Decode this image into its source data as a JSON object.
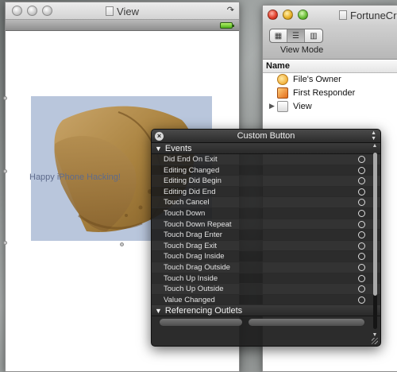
{
  "view_window": {
    "title": "View",
    "cookie_label": "Happy iPhone Hacking!"
  },
  "doc_window": {
    "title": "FortuneCr",
    "view_mode_label": "View Mode",
    "column_header": "Name",
    "items": [
      {
        "label": "File's Owner",
        "icon": "files-owner-icon"
      },
      {
        "label": "First Responder",
        "icon": "first-responder-icon"
      },
      {
        "label": "View",
        "icon": "view-object-icon"
      }
    ]
  },
  "inspector": {
    "title": "Custom Button",
    "events_header": "Events",
    "events": [
      "Did End On Exit",
      "Editing Changed",
      "Editing Did Begin",
      "Editing Did End",
      "Touch Cancel",
      "Touch Down",
      "Touch Down Repeat",
      "Touch Drag Enter",
      "Touch Drag Exit",
      "Touch Drag Inside",
      "Touch Drag Outside",
      "Touch Up Inside",
      "Touch Up Outside",
      "Value Changed"
    ],
    "outlets_header": "Referencing Outlets"
  }
}
